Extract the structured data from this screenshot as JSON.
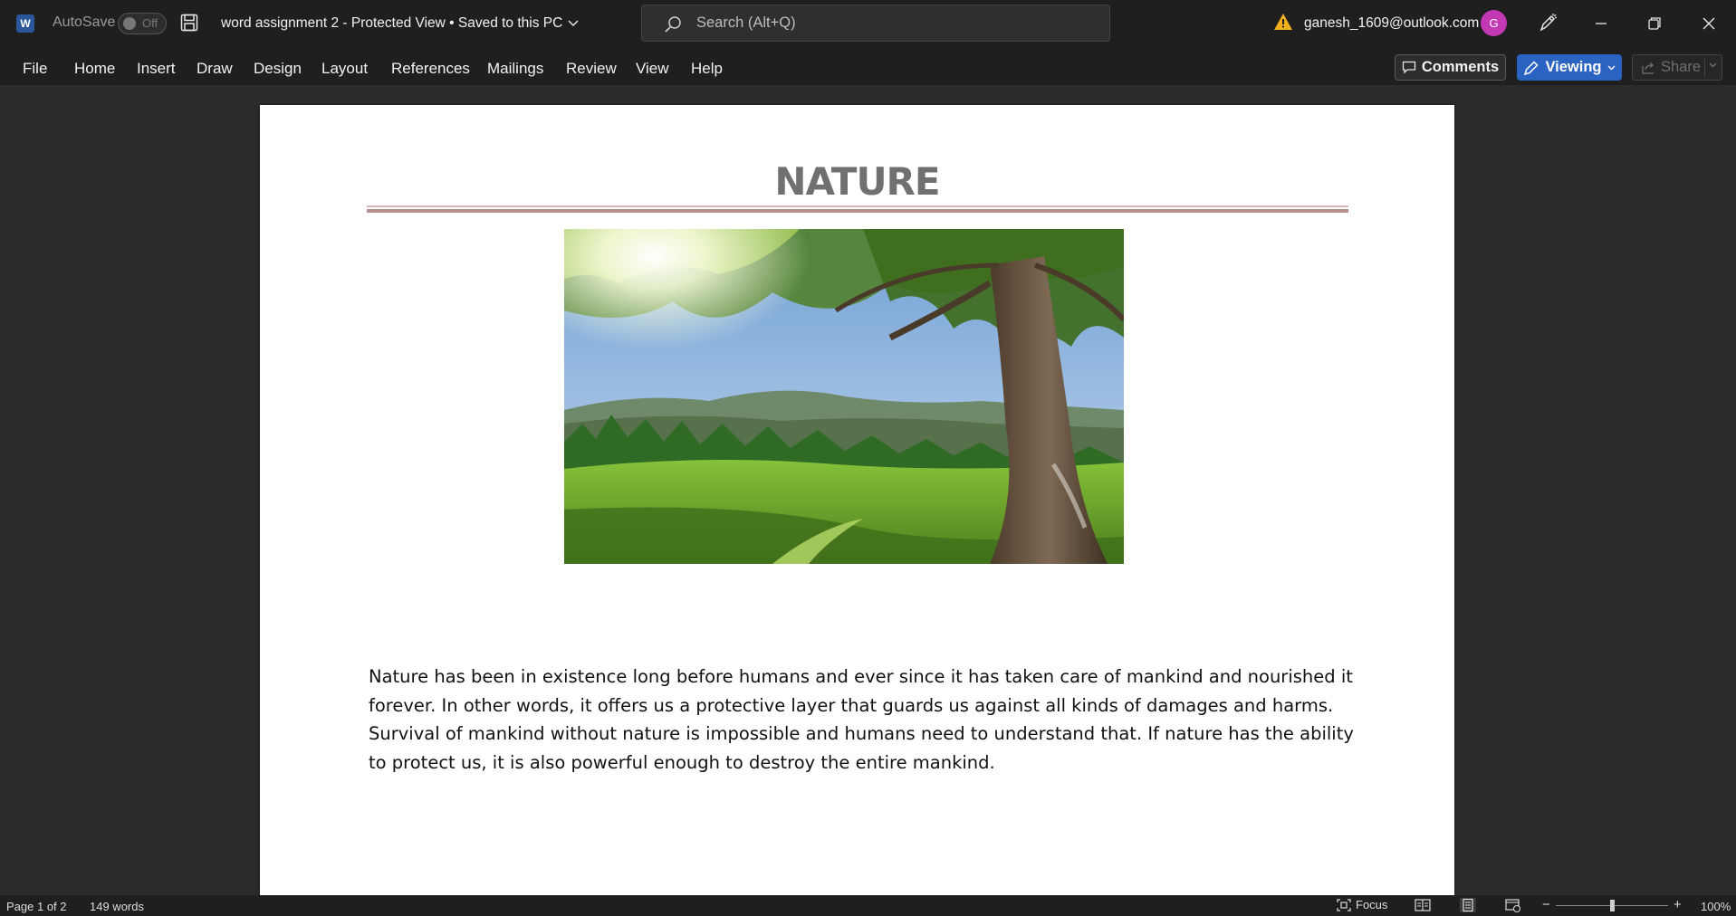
{
  "titlebar": {
    "app_icon_letter": "W",
    "autosave_label": "AutoSave",
    "autosave_state": "Off",
    "document_title": "word assignment 2  -  Protected View • Saved to this PC",
    "search_placeholder": "Search (Alt+Q)",
    "account_email": "ganesh_1609@outlook.com",
    "avatar_initial": "G"
  },
  "menubar": {
    "items": [
      "File",
      "Home",
      "Insert",
      "Draw",
      "Design",
      "Layout",
      "References",
      "Mailings",
      "Review",
      "View",
      "Help"
    ],
    "comments_label": "Comments",
    "viewing_label": "Viewing",
    "share_label": "Share"
  },
  "document": {
    "heading": "NATURE",
    "paragraph": "Nature has been in existence long before humans and ever since it has taken care of mankind and nourished it forever. In other words, it offers us a protective layer that guards us against all kinds of damages and harms. Survival of mankind without nature is impossible and humans need to understand that. If nature has the ability to protect us, it is also powerful enough to destroy the entire mankind.",
    "image_subject": "tree-meadow-photo"
  },
  "statusbar": {
    "page_info": "Page 1 of 2",
    "word_count": "149 words",
    "focus_label": "Focus",
    "zoom_label": "100%",
    "zoom_percent": 100
  },
  "colors": {
    "accent_blue": "#2b63c2",
    "avatar": "#c239b3",
    "heading": "#707070",
    "heading_rule": "#bb8e8e"
  }
}
